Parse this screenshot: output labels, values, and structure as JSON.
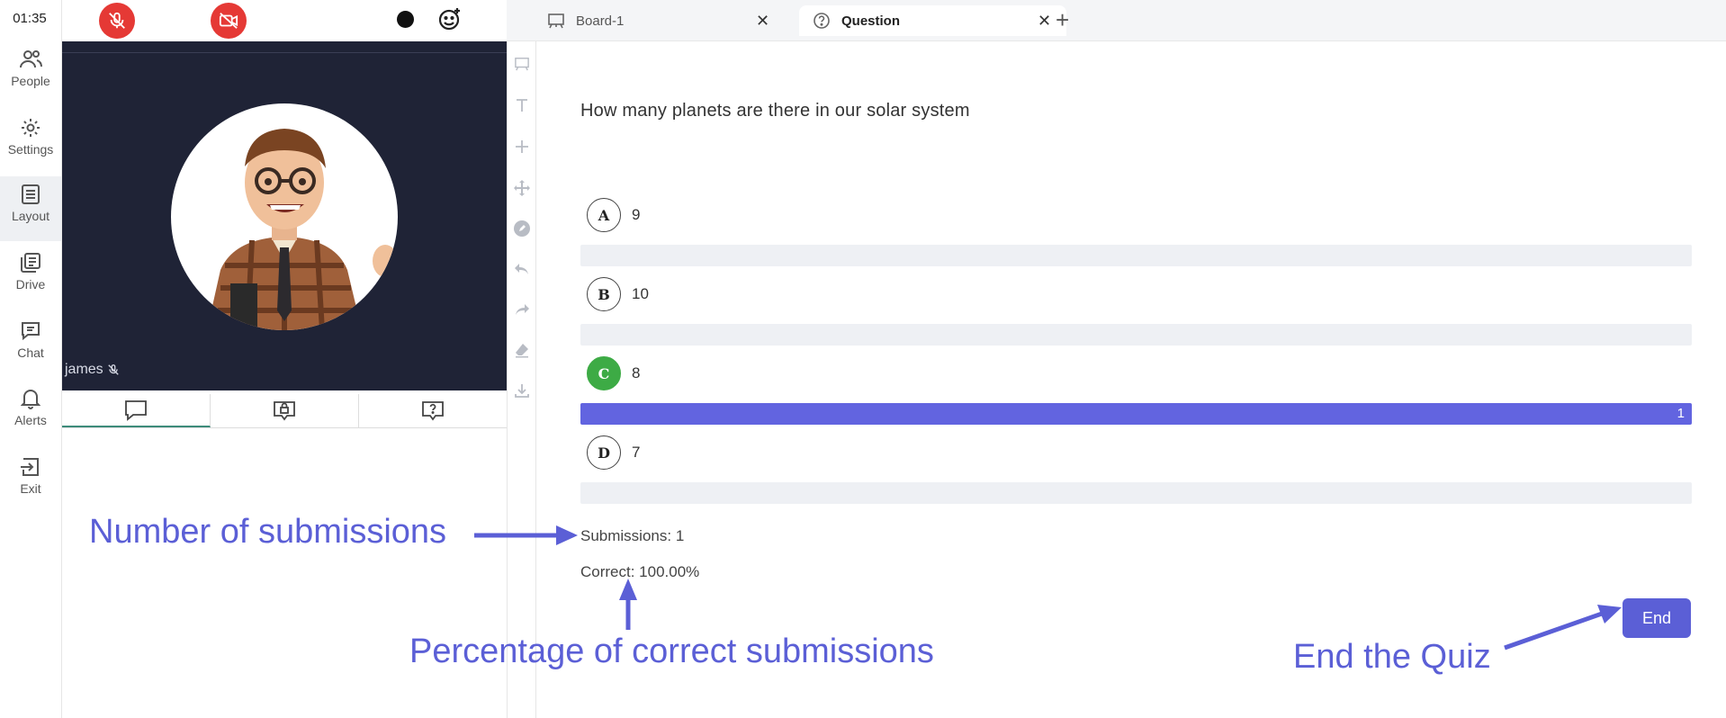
{
  "timer": "01:35",
  "sidebar": {
    "items": [
      {
        "label": "People",
        "icon": "people-icon"
      },
      {
        "label": "Settings",
        "icon": "gear-icon"
      },
      {
        "label": "Layout",
        "icon": "layout-icon"
      },
      {
        "label": "Drive",
        "icon": "drive-icon"
      },
      {
        "label": "Chat",
        "icon": "chat-icon"
      },
      {
        "label": "Alerts",
        "icon": "bell-icon"
      },
      {
        "label": "Exit",
        "icon": "exit-icon"
      }
    ]
  },
  "media": {
    "mic": "mic-muted-icon",
    "camera": "camera-off-icon",
    "record": "record-dot-icon",
    "reactions": "emoji-add-icon"
  },
  "video": {
    "participant_name": "james"
  },
  "tabs": [
    {
      "label": "Board-1",
      "icon": "whiteboard-icon"
    },
    {
      "label": "Question",
      "icon": "question-circle-icon"
    }
  ],
  "quiz": {
    "question": "How many planets are there in our solar system",
    "options": [
      {
        "letter": "A",
        "text": "9",
        "count": 0,
        "fraction": 0
      },
      {
        "letter": "B",
        "text": "10",
        "count": 0,
        "fraction": 0
      },
      {
        "letter": "C",
        "text": "8",
        "count": 1,
        "fraction": 1,
        "correct": true
      },
      {
        "letter": "D",
        "text": "7",
        "count": 0,
        "fraction": 0
      }
    ],
    "submissions_label": "Submissions: 1",
    "correct_label": "Correct: 100.00%",
    "end_label": "End"
  },
  "annotations": {
    "submissions": "Number of submissions",
    "percentage": "Percentage of correct submissions",
    "end": "End the Quiz"
  },
  "colors": {
    "accent": "#5b5fd6",
    "bar_fill": "#6264e0",
    "correct": "#3dab45",
    "danger": "#e53935",
    "video_bg": "#1f2336"
  }
}
